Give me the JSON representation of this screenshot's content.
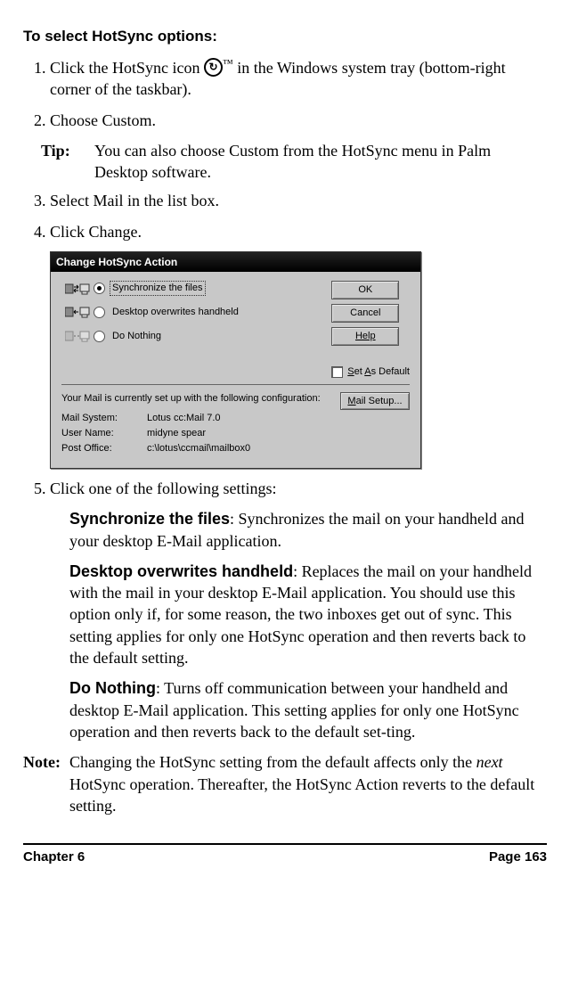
{
  "heading": "To select HotSync options:",
  "steps": {
    "s1_a": "Click the HotSync icon ",
    "s1_icon_glyph": "↻",
    "s1_tm": "™",
    "s1_b": " in the Windows system tray (bottom-right corner of the taskbar).",
    "s2": "Choose Custom.",
    "tip_label": "Tip:",
    "tip_text": "You can also choose Custom from the HotSync menu in Palm Desktop software.",
    "s3": "Select Mail in the list box.",
    "s4": "Click Change.",
    "s5": "Click one of the following settings:"
  },
  "dialog": {
    "title": "Change HotSync Action",
    "radios": {
      "sync": "Synchronize the files",
      "overwrite": "Desktop overwrites handheld",
      "nothing": "Do Nothing"
    },
    "buttons": {
      "ok": "OK",
      "cancel": "Cancel",
      "help": "Help",
      "mailsetup": "Mail Setup..."
    },
    "set_default": "Set As Default",
    "config_text": "Your Mail is currently set up with the following configuration:",
    "config": {
      "mail_system_k": "Mail System:",
      "mail_system_v": "Lotus cc:Mail 7.0",
      "user_name_k": "User Name:",
      "user_name_v": "midyne spear",
      "post_office_k": "Post Office:",
      "post_office_v": "c:\\lotus\\ccmail\\mailbox0"
    }
  },
  "settings": {
    "sync_name": "Synchronize the files",
    "sync_desc": ": Synchronizes the mail on your handheld and your desktop E-Mail application.",
    "overwrite_name": "Desktop overwrites handheld",
    "overwrite_desc": ": Replaces the mail on your handheld with the mail in your desktop E-Mail application. You should use this option only if, for some reason, the two inboxes get out of sync. This setting applies for only one HotSync operation and then reverts back to the default setting.",
    "nothing_name": "Do Nothing",
    "nothing_desc": ": Turns off communication between your handheld and desktop E-Mail application. This setting applies for only one HotSync operation and then reverts back to the default set-ting."
  },
  "note_label": "Note:",
  "note_a": "Changing the HotSync setting from the default affects only the ",
  "note_em": "next",
  "note_b": " HotSync operation. Thereafter, the HotSync Action reverts to the default setting.",
  "footer": {
    "chapter": "Chapter 6",
    "page": "Page 163"
  }
}
